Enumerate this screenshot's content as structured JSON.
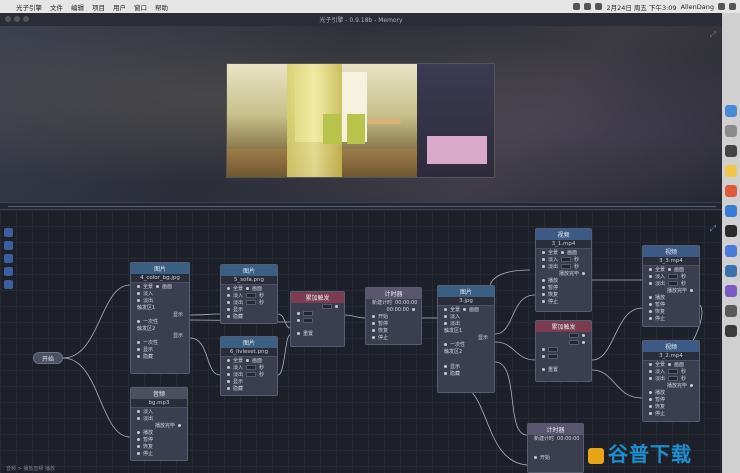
{
  "menubar": {
    "app": "光子引擎",
    "items": [
      "文件",
      "编辑",
      "项目",
      "用户",
      "窗口",
      "帮助"
    ],
    "clock": "2月24日 周五 下午3:09",
    "user": "AllenDang"
  },
  "window": {
    "title": "光子引擎 - 0.9.18b - Memory"
  },
  "start_node": {
    "label": "开始"
  },
  "status": {
    "text": "音频 > 播放音频 播放"
  },
  "watermark": {
    "text": "谷普下载"
  },
  "nodes": {
    "image1": {
      "header": "图片",
      "file": "4_color_bg.jpg",
      "r1": "全景",
      "r2": "画面",
      "in": "淡入",
      "out": "淡出",
      "l1": "触发区1",
      "l2": "显示",
      "l3": "一次性",
      "l4": "触发区2",
      "l5": "显示",
      "l6": "一次性",
      "show": "显示",
      "hide": "隐藏"
    },
    "image2": {
      "header": "图片",
      "file": "5_sofa.png",
      "r1": "全景",
      "r2": "画面",
      "in": "淡入",
      "out": "淡出",
      "unit": "秒",
      "show": "显示",
      "hide": "隐藏"
    },
    "image3": {
      "header": "图片",
      "file": "6_livleset.png",
      "r1": "全景",
      "r2": "画面",
      "in": "淡入",
      "out": "淡出",
      "unit": "秒",
      "show": "显示",
      "hide": "隐藏"
    },
    "trigger1": {
      "header": "累加触发",
      "reset": "重置"
    },
    "timer1": {
      "header": "计时器",
      "t1": "新建计时",
      "v1": "00:00:00",
      "v2": "00:00:00",
      "start": "开始",
      "pause": "暂停",
      "resume": "恢复",
      "stop": "停止"
    },
    "image4": {
      "header": "图片",
      "file": "3.jpg",
      "r1": "全景",
      "r2": "画面",
      "in": "淡入",
      "out": "淡出",
      "l1": "触发区1",
      "l2": "显示",
      "l3": "一次性",
      "l4": "触发区2",
      "show": "显示",
      "hide": "隐藏"
    },
    "video1": {
      "header": "视频",
      "file": "3_1.mp4",
      "r1": "全景",
      "r2": "画面",
      "in": "淡入",
      "out": "淡出",
      "unit": "秒",
      "end": "播放完毕",
      "play": "播放",
      "pause": "暂停",
      "resume": "恢复",
      "stop": "停止"
    },
    "trigger2": {
      "header": "累加触发",
      "reset": "重置"
    },
    "video2": {
      "header": "视频",
      "file": "3_3.mp4",
      "r1": "全景",
      "r2": "画面",
      "in": "淡入",
      "out": "淡出",
      "unit": "秒",
      "end": "播放完毕",
      "play": "播放",
      "pause": "暂停",
      "resume": "恢复",
      "stop": "停止"
    },
    "video3": {
      "header": "视频",
      "file": "3_2.mp4",
      "r1": "全景",
      "r2": "画面",
      "in": "淡入",
      "out": "淡出",
      "unit": "秒",
      "end": "播放完毕",
      "play": "播放",
      "pause": "暂停",
      "resume": "恢复",
      "stop": "停止"
    },
    "audio1": {
      "header": "音频",
      "file": "bg.mp3",
      "in": "淡入",
      "out": "淡出",
      "end": "播放完毕",
      "play": "播放",
      "pause": "暂停",
      "resume": "恢复",
      "stop": "停止"
    },
    "timer2": {
      "header": "计时器",
      "t1": "新建计时",
      "v1": "00:00:00",
      "start": "开始"
    }
  },
  "colors": {
    "image_header": "#3b5f83",
    "trigger_header": "#7a3c4e",
    "timer_header": "#5b5670",
    "wire": "#c9ccd6"
  }
}
